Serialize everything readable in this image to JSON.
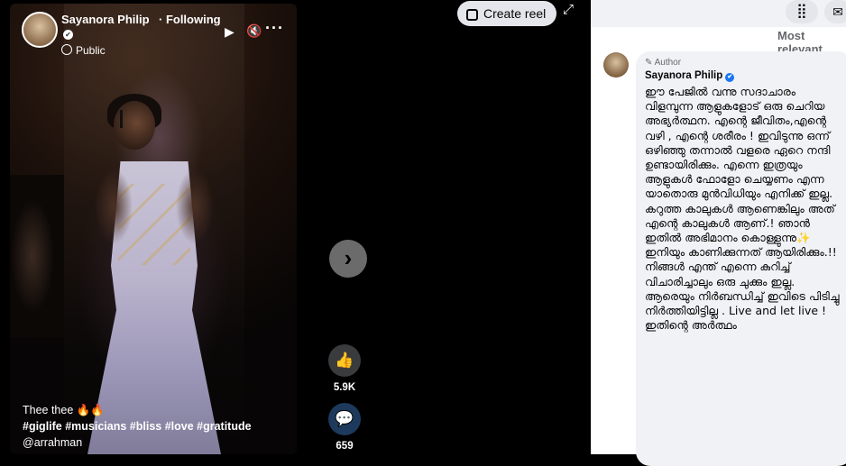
{
  "reel": {
    "author": "Sayanora Philip",
    "following": "· Following",
    "privacy": "Public",
    "caption_line1": "Thee thee 🔥🔥",
    "caption_tags": "#giglife #musicians #bliss #love #gratitude",
    "caption_mention": "@arrahman"
  },
  "toolbar": {
    "create_reel": "Create reel",
    "play_glyph": "▶",
    "mute_glyph": "🔇",
    "more_glyph": "···",
    "expand_glyph": "⤢",
    "next_glyph": "›"
  },
  "reactions": {
    "like_count": "5.9K",
    "comment_count": "659",
    "like_icon": "thumbs-up-icon",
    "comment_icon": "speech-bubble-icon"
  },
  "comments": {
    "sort_label": "Most relevant",
    "badge": "Author",
    "name": "Sayanora Philip",
    "text": "ഈ പേജിൽ വന്നു സദാചാരം വിളമ്പുന്ന ആളുകളോട് ഒരു ചെറിയ അഭ്യർത്ഥന. എന്റെ ജീവിതം,എന്റെ വഴി , എന്റെ ശരീരം ! ഇവിടുന്നു ഒന്ന് ഒഴിഞ്ഞു തന്നാൽ വളരെ ഏറെ നന്ദി ഉണ്ടായിരിക്കും. എന്നെ ഇത്രയും ആളുകൾ ഫോളോ ചെയ്യണം എന്ന യാതൊരു മുൻവിധിയും എനിക്ക് ഇല്ല. കറുത്ത കാലുകൾ ആണെങ്കിലും അത് എന്റെ കാലുകൾ ആണ്.! ഞാൻ ഇതിൽ അഭിമാനം കൊള്ളുന്നു✨ ഇനിയും കാണിക്കുന്നത് ആയിരിക്കും.!! നിങ്ങൾ എന്ത് എന്നെ കുറിച്ച് വിചാരിച്ചാലും ഒരു ചുക്കും ഇല്ല. ആരെയും നിർബന്ധിച്ച് ഇവിടെ പിടിച്ചു നിർത്തിയിട്ടില്ല . Live and let live ! ഇതിന്റെ അർത്ഥം"
  },
  "colors": {
    "accent": "#1877f2",
    "panel_bg": "#ffffff",
    "stage_bg": "#000000"
  }
}
